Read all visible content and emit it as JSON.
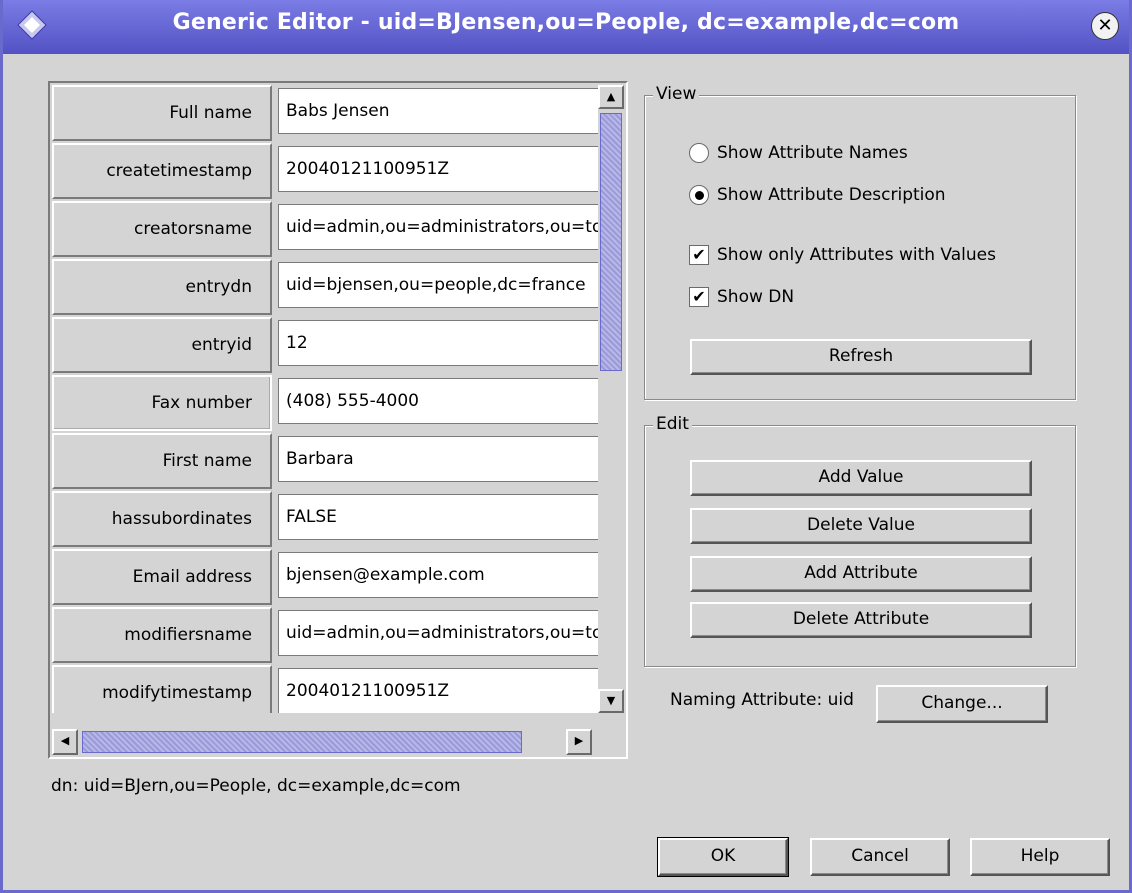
{
  "window": {
    "title": "Generic Editor - uid=BJensen,ou=People, dc=example,dc=com",
    "close_icon": "close-icon",
    "app_icon": "diamond-icon"
  },
  "attributes": [
    {
      "name": "Full name",
      "value": "Babs Jensen",
      "selected": false
    },
    {
      "name": "createtimestamp",
      "value": "20040121100951Z",
      "selected": false
    },
    {
      "name": "creatorsname",
      "value": "uid=admin,ou=administrators,ou=to",
      "selected": false
    },
    {
      "name": "entrydn",
      "value": "uid=bjensen,ou=people,dc=france",
      "selected": false
    },
    {
      "name": "entryid",
      "value": "12",
      "selected": false
    },
    {
      "name": "Fax number",
      "value": "(408) 555-4000",
      "selected": true
    },
    {
      "name": "First name",
      "value": "Barbara",
      "selected": false
    },
    {
      "name": "hassubordinates",
      "value": "FALSE",
      "selected": false
    },
    {
      "name": "Email address",
      "value": "bjensen@example.com",
      "selected": false
    },
    {
      "name": "modifiersname",
      "value": "uid=admin,ou=administrators,ou=to",
      "selected": false
    },
    {
      "name": "modifytimestamp",
      "value": "20040121100951Z",
      "selected": false
    }
  ],
  "dn_line": "dn: uid=BJern,ou=People, dc=example,dc=com",
  "view": {
    "title": "View",
    "show_attribute_names": "Show Attribute Names",
    "show_attribute_description": "Show Attribute Description",
    "show_only_with_values": "Show only Attributes with Values",
    "show_dn": "Show DN",
    "refresh": "Refresh",
    "selected_radio": "description",
    "only_with_values_checked": true,
    "show_dn_checked": true
  },
  "edit": {
    "title": "Edit",
    "add_value": "Add Value",
    "delete_value": "Delete Value",
    "add_attribute": "Add Attribute",
    "delete_attribute": "Delete Attribute"
  },
  "naming": {
    "label": "Naming Attribute: uid",
    "change": "Change..."
  },
  "footer": {
    "ok": "OK",
    "cancel": "Cancel",
    "help": "Help"
  }
}
